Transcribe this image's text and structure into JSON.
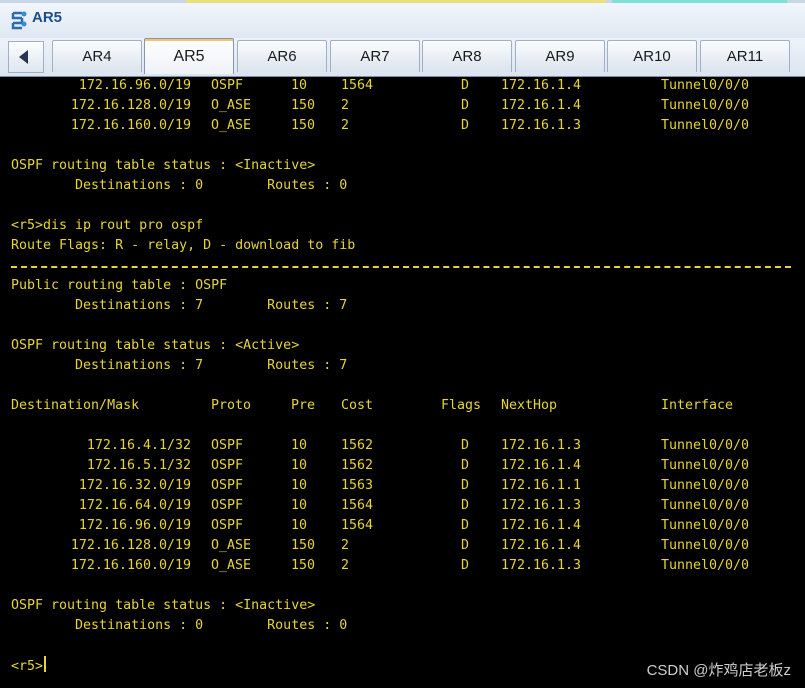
{
  "window": {
    "title": "AR5"
  },
  "tabs": [
    {
      "label": "AR4"
    },
    {
      "label": "AR5",
      "active": true
    },
    {
      "label": "AR6"
    },
    {
      "label": "AR7"
    },
    {
      "label": "AR8"
    },
    {
      "label": "AR9"
    },
    {
      "label": "AR10"
    },
    {
      "label": "AR11"
    }
  ],
  "terminal": {
    "prev_routes": [
      [
        "172.16.96.0/19",
        "OSPF",
        "10",
        "1564",
        "D",
        "172.16.1.4",
        "Tunnel0/0/0"
      ],
      [
        "172.16.128.0/19",
        "O_ASE",
        "150",
        "2",
        "D",
        "172.16.1.4",
        "Tunnel0/0/0"
      ],
      [
        "172.16.160.0/19",
        "O_ASE",
        "150",
        "2",
        "D",
        "172.16.1.3",
        "Tunnel0/0/0"
      ]
    ],
    "prev_inactive_status": "OSPF routing table status : <Inactive>",
    "prev_inactive_counts": "        Destinations : 0        Routes : 0",
    "command": "<r5>dis ip rout pro ospf",
    "flags_line": "Route Flags: R - relay, D - download to fib",
    "public_table": "Public routing table : OSPF",
    "public_counts": "        Destinations : 7        Routes : 7",
    "active_status": "OSPF routing table status : <Active>",
    "active_counts": "        Destinations : 7        Routes : 7",
    "columns": [
      "Destination/Mask",
      "Proto",
      "Pre",
      "Cost",
      "Flags",
      "NextHop",
      "Interface"
    ],
    "routes": [
      [
        "172.16.4.1/32",
        "OSPF",
        "10",
        "1562",
        "D",
        "172.16.1.3",
        "Tunnel0/0/0"
      ],
      [
        "172.16.5.1/32",
        "OSPF",
        "10",
        "1562",
        "D",
        "172.16.1.4",
        "Tunnel0/0/0"
      ],
      [
        "172.16.32.0/19",
        "OSPF",
        "10",
        "1563",
        "D",
        "172.16.1.1",
        "Tunnel0/0/0"
      ],
      [
        "172.16.64.0/19",
        "OSPF",
        "10",
        "1564",
        "D",
        "172.16.1.3",
        "Tunnel0/0/0"
      ],
      [
        "172.16.96.0/19",
        "OSPF",
        "10",
        "1564",
        "D",
        "172.16.1.4",
        "Tunnel0/0/0"
      ],
      [
        "172.16.128.0/19",
        "O_ASE",
        "150",
        "2",
        "D",
        "172.16.1.4",
        "Tunnel0/0/0"
      ],
      [
        "172.16.160.0/19",
        "O_ASE",
        "150",
        "2",
        "D",
        "172.16.1.3",
        "Tunnel0/0/0"
      ]
    ],
    "inactive_status": "OSPF routing table status : <Inactive>",
    "inactive_counts": "        Destinations : 0        Routes : 0",
    "prompt": "<r5>"
  },
  "watermark": "CSDN @炸鸡店老板z",
  "colors": {
    "terminal_text": "#e6d43a",
    "terminal_bg": "#000000"
  }
}
